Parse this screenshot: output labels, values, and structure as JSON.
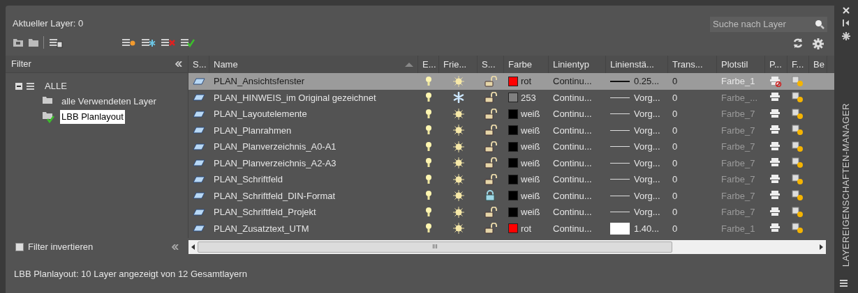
{
  "header": {
    "current_layer": "Aktueller Layer: 0",
    "search": {
      "placeholder": "Suche nach Layer"
    }
  },
  "filter_panel": {
    "title": "Filter",
    "tree": [
      {
        "label": "ALLE",
        "expanded": true,
        "selected": false,
        "children": [
          {
            "label": "alle Verwendeten Layer",
            "selected": false
          },
          {
            "label": "LBB Planlayout",
            "selected": true
          }
        ]
      }
    ],
    "invert": {
      "label": "Filter invertieren",
      "checked": false
    }
  },
  "table": {
    "columns": [
      {
        "label": "S...",
        "sorted": false
      },
      {
        "label": "Name",
        "sorted": true
      },
      {
        "label": "E...",
        "sorted": false
      },
      {
        "label": "Frie...",
        "sorted": false
      },
      {
        "label": "S...",
        "sorted": false
      },
      {
        "label": "Farbe",
        "sorted": false
      },
      {
        "label": "Linientyp",
        "sorted": false
      },
      {
        "label": "Linienstä...",
        "sorted": false
      },
      {
        "label": "Trans...",
        "sorted": false
      },
      {
        "label": "Plotstil",
        "sorted": false
      },
      {
        "label": "P...",
        "sorted": false
      },
      {
        "label": "F...",
        "sorted": false
      },
      {
        "label": "Be",
        "sorted": false
      }
    ],
    "rows": [
      {
        "name": "PLAN_Ansichtsfenster",
        "selected": true,
        "on": true,
        "frozen": false,
        "locked": false,
        "color": "#ff0000",
        "color_name": "rot",
        "linetype": "Continu...",
        "lineweight": {
          "kind": "thick",
          "text": "0.25..."
        },
        "transparency": "0",
        "plotstyle": "Farbe_1",
        "plot": false
      },
      {
        "name": "PLAN_HINWEIS_im Original gezeichnet",
        "selected": false,
        "on": true,
        "frozen": true,
        "locked": false,
        "color": "#808080",
        "color_name": "253",
        "linetype": "Continu...",
        "lineweight": {
          "kind": "line",
          "text": "Vorg..."
        },
        "transparency": "0",
        "plotstyle": "Farbe_...",
        "plot": true
      },
      {
        "name": "PLAN_Layoutelemente",
        "selected": false,
        "on": true,
        "frozen": false,
        "locked": false,
        "color": "#000000",
        "color_name": "weiß",
        "linetype": "Continu...",
        "lineweight": {
          "kind": "line",
          "text": "Vorg..."
        },
        "transparency": "0",
        "plotstyle": "Farbe_7",
        "plot": true
      },
      {
        "name": "PLAN_Planrahmen",
        "selected": false,
        "on": true,
        "frozen": false,
        "locked": false,
        "color": "#000000",
        "color_name": "weiß",
        "linetype": "Continu...",
        "lineweight": {
          "kind": "line",
          "text": "Vorg..."
        },
        "transparency": "0",
        "plotstyle": "Farbe_7",
        "plot": true
      },
      {
        "name": "PLAN_Planverzeichnis_A0-A1",
        "selected": false,
        "on": true,
        "frozen": false,
        "locked": false,
        "color": "#000000",
        "color_name": "weiß",
        "linetype": "Continu...",
        "lineweight": {
          "kind": "line",
          "text": "Vorg..."
        },
        "transparency": "0",
        "plotstyle": "Farbe_7",
        "plot": true
      },
      {
        "name": "PLAN_Planverzeichnis_A2-A3",
        "selected": false,
        "on": true,
        "frozen": false,
        "locked": false,
        "color": "#000000",
        "color_name": "weiß",
        "linetype": "Continu...",
        "lineweight": {
          "kind": "line",
          "text": "Vorg..."
        },
        "transparency": "0",
        "plotstyle": "Farbe_7",
        "plot": true
      },
      {
        "name": "PLAN_Schriftfeld",
        "selected": false,
        "on": true,
        "frozen": false,
        "locked": false,
        "color": "#000000",
        "color_name": "weiß",
        "linetype": "Continu...",
        "lineweight": {
          "kind": "line",
          "text": "Vorg..."
        },
        "transparency": "0",
        "plotstyle": "Farbe_7",
        "plot": true
      },
      {
        "name": "PLAN_Schriftfeld_DIN-Format",
        "selected": false,
        "on": true,
        "frozen": false,
        "locked": true,
        "color": "#000000",
        "color_name": "weiß",
        "linetype": "Continu...",
        "lineweight": {
          "kind": "line",
          "text": "Vorg..."
        },
        "transparency": "0",
        "plotstyle": "Farbe_7",
        "plot": true
      },
      {
        "name": "PLAN_Schriftfeld_Projekt",
        "selected": false,
        "on": true,
        "frozen": false,
        "locked": false,
        "color": "#000000",
        "color_name": "weiß",
        "linetype": "Continu...",
        "lineweight": {
          "kind": "line",
          "text": "Vorg..."
        },
        "transparency": "0",
        "plotstyle": "Farbe_7",
        "plot": true
      },
      {
        "name": "PLAN_Zusatztext_UTM",
        "selected": false,
        "on": true,
        "frozen": false,
        "locked": false,
        "color": "#ff0000",
        "color_name": "rot",
        "linetype": "Continu...",
        "lineweight": {
          "kind": "box",
          "text": "1.40..."
        },
        "transparency": "0",
        "plotstyle": "Farbe_1",
        "plot": true
      }
    ]
  },
  "scrollbar": {
    "thumb": "III"
  },
  "status_bar": "LBB Planlayout: 10 Layer angezeigt von 12 Gesamtlayern",
  "side_title": "LAYEREIGENSCHAFTEN-MANAGER"
}
